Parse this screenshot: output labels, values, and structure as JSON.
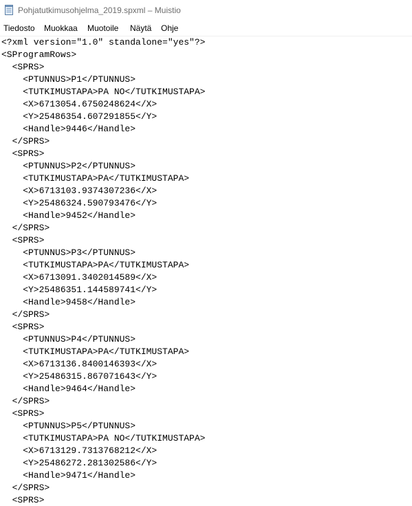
{
  "window": {
    "title": "Pohjatutkimusohjelma_2019.spxml – Muistio",
    "icon": "notepad-icon"
  },
  "menu": [
    "Tiedosto",
    "Muokkaa",
    "Muotoile",
    "Näytä",
    "Ohje"
  ],
  "editor": {
    "lines": [
      "<?xml version=\"1.0\" standalone=\"yes\"?>",
      "<SProgramRows>",
      "  <SPRS>",
      "    <PTUNNUS>P1</PTUNNUS>",
      "    <TUTKIMUSTAPA>PA NO</TUTKIMUSTAPA>",
      "    <X>6713054.6750248624</X>",
      "    <Y>25486354.607291855</Y>",
      "    <Handle>9446</Handle>",
      "  </SPRS>",
      "  <SPRS>",
      "    <PTUNNUS>P2</PTUNNUS>",
      "    <TUTKIMUSTAPA>PA</TUTKIMUSTAPA>",
      "    <X>6713103.9374307236</X>",
      "    <Y>25486324.590793476</Y>",
      "    <Handle>9452</Handle>",
      "  </SPRS>",
      "  <SPRS>",
      "    <PTUNNUS>P3</PTUNNUS>",
      "    <TUTKIMUSTAPA>PA</TUTKIMUSTAPA>",
      "    <X>6713091.3402014589</X>",
      "    <Y>25486351.144589741</Y>",
      "    <Handle>9458</Handle>",
      "  </SPRS>",
      "  <SPRS>",
      "    <PTUNNUS>P4</PTUNNUS>",
      "    <TUTKIMUSTAPA>PA</TUTKIMUSTAPA>",
      "    <X>6713136.8400146393</X>",
      "    <Y>25486315.867071643</Y>",
      "    <Handle>9464</Handle>",
      "  </SPRS>",
      "  <SPRS>",
      "    <PTUNNUS>P5</PTUNNUS>",
      "    <TUTKIMUSTAPA>PA NO</TUTKIMUSTAPA>",
      "    <X>6713129.7313768212</X>",
      "    <Y>25486272.281302586</Y>",
      "    <Handle>9471</Handle>",
      "  </SPRS>",
      "  <SPRS>"
    ]
  }
}
